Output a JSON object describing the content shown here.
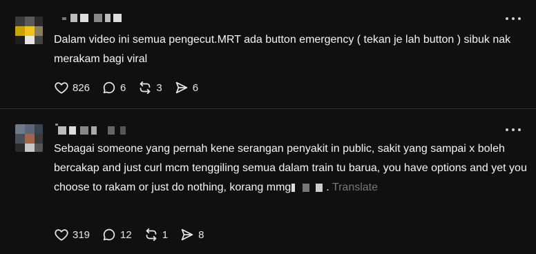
{
  "thread": [
    {
      "text": "Dalam video ini semua pengecut.MRT ada button emergency ( tekan je lah button ) sibuk nak merakam bagi viral",
      "translate_label": "",
      "stats": {
        "likes": "826",
        "replies": "6",
        "reposts": "3",
        "shares": "6"
      }
    },
    {
      "text": "Sebagai someone yang pernah kene serangan penyakit in public, sakit yang sampai x boleh bercakap and just curl mcm tenggiling semua dalam train tu barua, you have options and yet you choose to rakam or just do nothing, korang mmg",
      "text_suffix": ".",
      "translate_label": "Translate",
      "stats": {
        "likes": "319",
        "replies": "12",
        "reposts": "1",
        "shares": "8"
      }
    }
  ],
  "icons": {
    "like": "heart-icon",
    "reply": "speech-bubble-icon",
    "repost": "repost-icon",
    "share": "send-icon",
    "more": "more-dots-icon"
  },
  "colors": {
    "background": "#101010",
    "text": "#f3f5f7",
    "muted": "#777777",
    "divider": "#2f2f2f"
  }
}
